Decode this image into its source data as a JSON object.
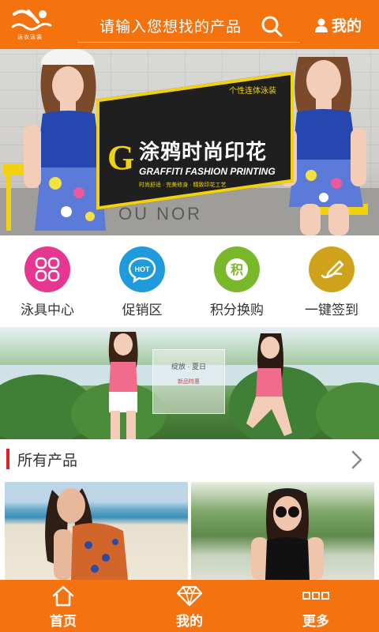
{
  "header": {
    "logo_text": "泳衣泳装",
    "search_placeholder": "请输入您想找的产品",
    "mine_label": "我的"
  },
  "banner": {
    "tagline": "个性连体泳装",
    "letter": "G",
    "title": "涂鸦时尚印花",
    "subtitle": "GRAFFITI FASHION PRINTING",
    "tiny_text": "时尚舒适 · 完美修身 · 精致印花工艺",
    "wall_text": "OU NOR"
  },
  "quicknav": [
    {
      "label": "泳具中心",
      "icon": "grid-icon",
      "color": "#e6368f"
    },
    {
      "label": "促销区",
      "icon": "hot-chat-icon",
      "color": "#1f9bdc"
    },
    {
      "label": "积分换购",
      "icon": "points-icon",
      "color": "#79b82b"
    },
    {
      "label": "一键签到",
      "icon": "pencil-icon",
      "color": "#d0a21c"
    }
  ],
  "banner2": {
    "card_line1": "绽放 · 夏日",
    "card_line2": "新品特惠"
  },
  "section": {
    "title": "所有产品"
  },
  "bottomnav": [
    {
      "label": "首页",
      "icon": "home-icon"
    },
    {
      "label": "我的",
      "icon": "diamond-icon"
    },
    {
      "label": "更多",
      "icon": "more-icon"
    }
  ],
  "colors": {
    "accent": "#f5730f",
    "section_bar": "#e31e26"
  }
}
